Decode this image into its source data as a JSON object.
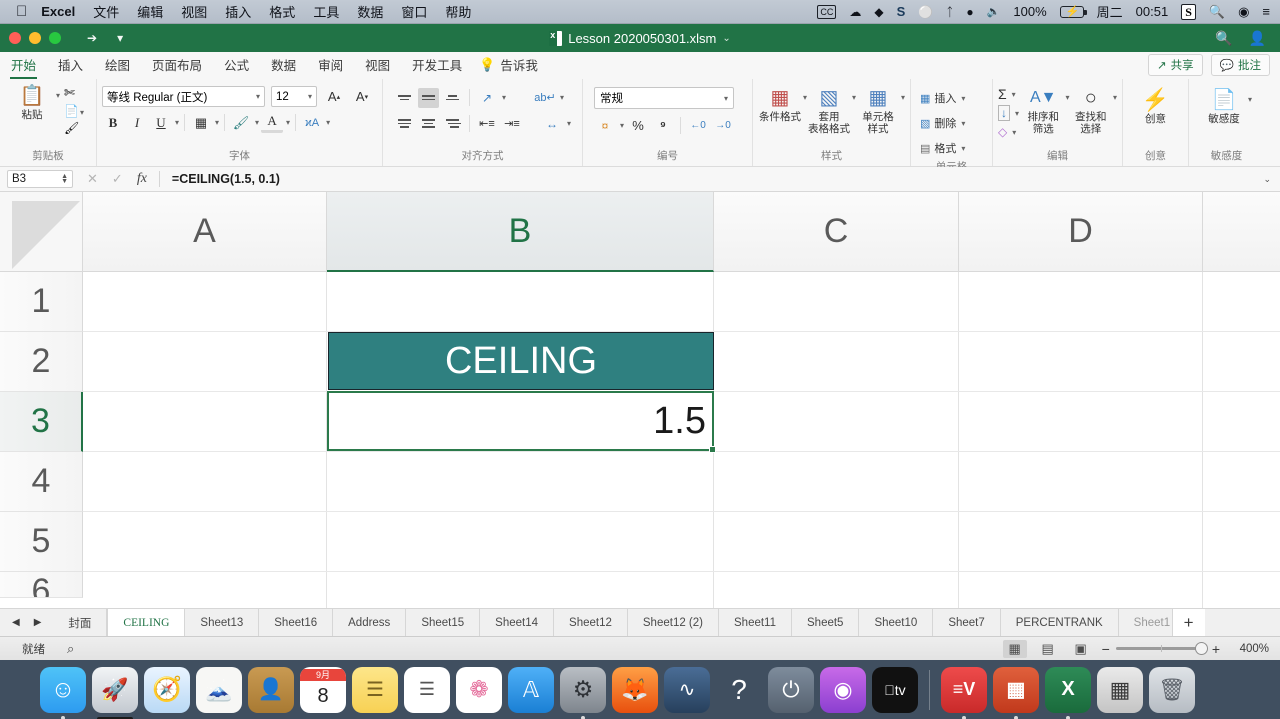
{
  "macbar": {
    "apple_icon": "apple-icon",
    "app_name": "Excel",
    "menus": [
      "文件",
      "编辑",
      "视图",
      "插入",
      "格式",
      "工具",
      "数据",
      "窗口",
      "帮助"
    ],
    "status_items": {
      "cc_label": "CC",
      "battery_percent": "100%",
      "day": "周二",
      "time": "00:51",
      "s_icon_label": "S"
    }
  },
  "titlebar": {
    "filename": "Lesson 2020050301.xlsm",
    "dropdown_caret": "⌄",
    "search_icon": "search-icon",
    "account_icon": "account-icon"
  },
  "ribbon_tabs": {
    "tabs": [
      "开始",
      "插入",
      "绘图",
      "页面布局",
      "公式",
      "数据",
      "审阅",
      "视图",
      "开发工具"
    ],
    "active_index": 0,
    "tell_me": "告诉我",
    "share": "共享",
    "comments": "批注"
  },
  "ribbon": {
    "clipboard": {
      "label": "剪贴板",
      "paste": "粘贴",
      "cut_icon": "scissors-icon",
      "copy_icon": "copy-icon",
      "format_painter_icon": "format-painter-icon"
    },
    "font": {
      "label": "字体",
      "font_name": "等线 Regular (正文)",
      "font_size": "12",
      "grow_font": "A",
      "shrink_font": "A",
      "bold": "B",
      "italic": "I",
      "underline": "U",
      "borders_icon": "borders-icon",
      "fill_color_icon": "fill-color-icon",
      "font_color": "A",
      "phonetic_icon": "phonetic-guide-icon"
    },
    "alignment": {
      "label": "对齐方式",
      "top_align": "top-align-icon",
      "middle_align": "middle-align-icon",
      "bottom_align": "bottom-align-icon",
      "orientation_icon": "text-orientation-icon",
      "align_left": "align-left-icon",
      "align_center": "align-center-icon",
      "align_right": "align-right-icon",
      "decrease_indent": "decrease-indent-icon",
      "increase_indent": "increase-indent-icon",
      "wrap_text_icon": "wrap-text-icon",
      "merge_center_icon": "merge-center-icon"
    },
    "number": {
      "label": "编号",
      "format": "常规",
      "currency_icon": "currency-icon",
      "percent": "%",
      "comma": "⁹",
      "increase_decimal": "increase-decimal-icon",
      "decrease_decimal": "decrease-decimal-icon"
    },
    "styles": {
      "label": "样式",
      "conditional": "条件格式",
      "table_style_l1": "套用",
      "table_style_l2": "表格格式",
      "cell_style_l1": "单元格",
      "cell_style_l2": "样式"
    },
    "cells": {
      "label": "单元格",
      "insert": "插入",
      "delete": "删除",
      "format": "格式"
    },
    "editing": {
      "label": "编辑",
      "autosum": "Σ",
      "fill_icon": "fill-down-icon",
      "clear_icon": "eraser-icon",
      "sort_l1": "排序和",
      "sort_l2": "筛选",
      "find_l1": "查找和",
      "find_l2": "选择"
    },
    "ideas": {
      "label": "创意",
      "button": "创意",
      "icon": "lightning-icon"
    },
    "sensitivity": {
      "label": "敏感度",
      "button": "敏感度",
      "icon": "sensitivity-icon"
    }
  },
  "formula_bar": {
    "name_box": "B3",
    "cancel_icon": "cancel-icon",
    "confirm_icon": "confirm-icon",
    "fx_icon": "fx-icon",
    "formula": "=CEILING(1.5, 0.1)",
    "expand_caret": "⌄"
  },
  "grid": {
    "columns": [
      "A",
      "B",
      "C",
      "D"
    ],
    "selected_column": "B",
    "rows": [
      "1",
      "2",
      "3",
      "4",
      "5",
      "6"
    ],
    "selected_row": "3",
    "cells": {
      "b2": {
        "value": "CEILING",
        "fill": "#2f8080",
        "text_color": "#ffffff"
      },
      "b3": {
        "value": "1.5",
        "border_color": "#2b7a4b"
      }
    }
  },
  "sheet_tabs": {
    "prev_icon": "prev-sheet-icon",
    "next_icon": "next-sheet-icon",
    "tabs": [
      "封面",
      "CEILING",
      "Sheet13",
      "Sheet16",
      "Address",
      "Sheet15",
      "Sheet14",
      "Sheet12",
      "Sheet12 (2)",
      "Sheet11",
      "Sheet5",
      "Sheet10",
      "Sheet7",
      "PERCENTRANK",
      "Sheet1"
    ],
    "active": "CEILING",
    "add_label": "+"
  },
  "status_bar": {
    "status": "就绪",
    "select_icon": "selection-mode-icon",
    "view_normal": "normal-view-icon",
    "view_layout": "page-layout-icon",
    "view_break": "page-break-icon",
    "zoom_out": "−",
    "zoom_in": "+",
    "zoom_level": "400%"
  },
  "dock": {
    "items": [
      {
        "name": "finder",
        "glyph": "☺",
        "bg": "#2d9bf0",
        "running": true
      },
      {
        "name": "launchpad",
        "glyph": "🚀",
        "bg": "#cfd3d8",
        "running": false
      },
      {
        "name": "safari",
        "glyph": "🧭",
        "bg": "#2d9bf0",
        "running": false
      },
      {
        "name": "mail",
        "glyph": "✉",
        "bg": "#f2f2f2",
        "running": false
      },
      {
        "name": "contacts",
        "glyph": "👤",
        "bg": "#b4823c",
        "running": false
      },
      {
        "name": "calendar",
        "glyph": "8",
        "bg": "#ffffff",
        "running": false
      },
      {
        "name": "notes",
        "glyph": "▤",
        "bg": "#fbe07a",
        "running": false
      },
      {
        "name": "reminders",
        "glyph": "☰",
        "bg": "#ffffff",
        "running": false
      },
      {
        "name": "photos",
        "glyph": "❁",
        "bg": "#ffffff",
        "running": false
      },
      {
        "name": "app-store",
        "glyph": "A",
        "bg": "#2d9bf0",
        "running": false
      },
      {
        "name": "system-preferences",
        "glyph": "⚙",
        "bg": "#8c8c8c",
        "running": true
      },
      {
        "name": "firefox",
        "glyph": "🦊",
        "bg": "#ff7139",
        "running": false
      },
      {
        "name": "sequel-pro",
        "glyph": "⌁",
        "bg": "#3a4a63",
        "running": false
      },
      {
        "name": "help-viewer",
        "glyph": "?",
        "bg": "#46576b",
        "running": false
      },
      {
        "name": "power",
        "glyph": "⏻",
        "bg": "#5a6a7d",
        "running": false
      },
      {
        "name": "podcasts",
        "glyph": "◉",
        "bg": "#9b5de5",
        "running": false
      },
      {
        "name": "apple-tv",
        "glyph": "tv",
        "bg": "#1a1a1a",
        "running": false
      },
      {
        "name": "evernote",
        "glyph": "=V",
        "bg": "#e03131",
        "running": true
      },
      {
        "name": "powerpoint",
        "glyph": "P",
        "bg": "#d24726",
        "running": true
      },
      {
        "name": "excel",
        "glyph": "X",
        "bg": "#217346",
        "running": true
      },
      {
        "name": "calculator",
        "glyph": "▦",
        "bg": "#d7d7d7",
        "running": false
      },
      {
        "name": "trash",
        "glyph": "🗑",
        "bg": "#c9cdd2",
        "running": false
      }
    ],
    "calendar_month": "9月",
    "calendar_day": "8"
  }
}
